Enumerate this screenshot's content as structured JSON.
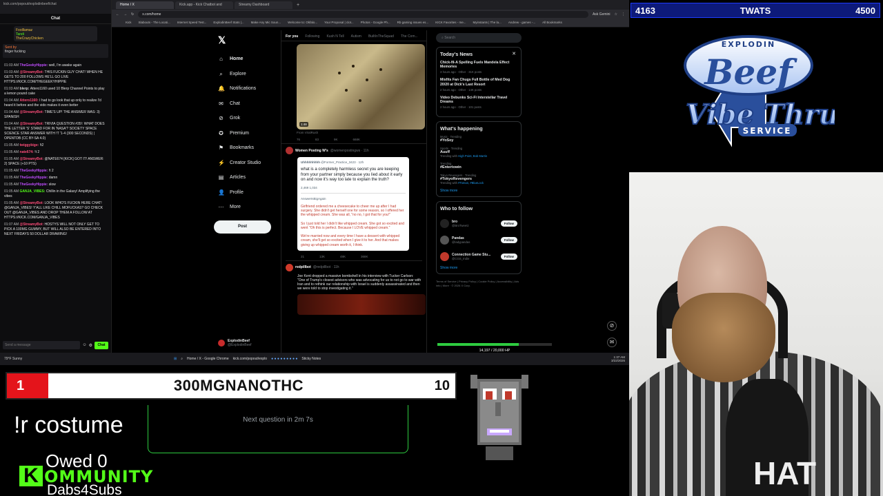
{
  "chat": {
    "url": "kick.com/popout/explodinbeef/chat",
    "title": "Chat",
    "pinned": {
      "line1": "Foolllamaz",
      "line2": "Tandi",
      "line3": "TheCrazyChicken"
    },
    "sent_by": "Sent by",
    "sent_text": "finger fucking",
    "messages": [
      {
        "ts": "01:03 AM",
        "user": "TheGeekyHippie:",
        "color": "#c04dff",
        "text": "well, I'm awake again"
      },
      {
        "ts": "01:03 AM",
        "user": "@StreamyBot:",
        "color": "#ff4d7a",
        "text": "THIS FUCKIN GUY CHAT! WHEN HE GETS TO 200 FOLLOWS HE'LL GO LIVE HTTPS://KICK.COM/THEGEEKYHIPPIE"
      },
      {
        "ts": "01:03 AM",
        "user": "blerp:",
        "color": "#dddddd",
        "text": "Attero1160 used 10 Blerp Channel Points to play a lemon pound cake"
      },
      {
        "ts": "01:04 AM",
        "user": "Attero1160:",
        "color": "#ff4d7a",
        "text": "I had to go look that up only to realize I'd heard it before and the vido makes it even better"
      },
      {
        "ts": "01:04 AM",
        "user": "@StreamyBot:",
        "color": "#ff4d7a",
        "text": "TIME'S UP! THE ANSWER WAS: 3) SPANISH"
      },
      {
        "ts": "01:04 AM",
        "user": "@StreamyBot:",
        "color": "#ff4d7a",
        "text": "TRIVIA QUESTION #35!: WHAT DOES THE LETTER 'S' STAND FOR IN 'NASA'? SOCIETY SPACE SCIENCE STAR ANSWER WITH !T '1-4 (300 SECONDS) | OPENTDB (CC BY-SA 4.0)"
      },
      {
        "ts": "01:05 AM",
        "user": "twiggybige:",
        "color": "#ff4d7a",
        "text": "!t2"
      },
      {
        "ts": "01:05 AM",
        "user": "nate674:",
        "color": "#ff4d7a",
        "text": "!t 2"
      },
      {
        "ts": "01:05 AM",
        "user": "@StreamyBot:",
        "color": "#ff4d7a",
        "text": "@NATE674 [KICK] GOT IT! ANSWER: 2) SPACE (+10 PTS)"
      },
      {
        "ts": "01:05 AM",
        "user": "TheGeekyHippie:",
        "color": "#c04dff",
        "text": "!t 2"
      },
      {
        "ts": "01:05 AM",
        "user": "TheGeekyHippie:",
        "color": "#c04dff",
        "text": "damn"
      },
      {
        "ts": "01:05 AM",
        "user": "TheGeekyHippie:",
        "color": "#c04dff",
        "text": "slow"
      },
      {
        "ts": "01:05 AM",
        "user": "GANJA_VIBES:",
        "color": "#53fc18",
        "text": "Chillin in the Galaxy! Amplifying the vibes"
      },
      {
        "ts": "01:05 AM",
        "user": "@StreamyBot:",
        "color": "#ff4d7a",
        "text": "LOOK WHO'S FUCKIN HERE CHAT! @GANJA_VIBES! Y'ALL LIKE CHILL MOFUCKAS? GO CHECK OUT @GANJA_VIBES AND DROP THEM A FOLLOW AT HTTPS://KICK.COM/GANJA_VIBES"
      },
      {
        "ts": "01:07 AM",
        "user": "@StreamyBot:",
        "color": "#ff4d7a",
        "text": "HOSTYS WILL NOT ONLY GET TO PICK A 100MG GUMMY, BUT WILL ALSO BE ENTERED INTO NEXT FRIDAYS 50 DOLLAR DRAWING!"
      }
    ],
    "input_placeholder": "Send a message",
    "send_label": "Chat"
  },
  "browser": {
    "tabs": [
      "Home / X",
      "Kick.app - Kick Chatbot and",
      "Streamy Dashboard"
    ],
    "url": "x.com/home",
    "bookmarks": [
      "Kick",
      "Slabouts - The Locati...",
      "Internet Speed Test...",
      "ExplodinBeef Stats |...",
      "Make Any Mic Soun...",
      "Welcome to: Okfalo...",
      "Your Proposal | clot...",
      "Photos - Google Ph...",
      "Rb gaming issues es...",
      "KICK Favorites - me...",
      "Myinstants | The la...",
      "Andrew - games -...",
      "All Bookmarks"
    ],
    "ask": "Ask Gemini"
  },
  "x": {
    "nav": [
      "Home",
      "Explore",
      "Notifications",
      "Chat",
      "Grok",
      "Premium",
      "Bookmarks",
      "Creator Studio",
      "Articles",
      "Profile",
      "More"
    ],
    "post_button": "Post",
    "me_name": "ExplodinBeef",
    "me_handle": "@ExplodinBeef",
    "feed_tabs": [
      "For you",
      "Following",
      "Kush N Tell",
      "Autism",
      "BuiltInTheSquad",
      "The Com..."
    ],
    "video_duration": "1:48",
    "video_source": "From ViralRush",
    "actions1": [
      "76",
      "83",
      "9K",
      "668K"
    ],
    "post1": {
      "name": "Women Posting W's",
      "handle": "@womenpostingws · 11h",
      "quote_user": "Uhhhhhhhhh",
      "quote_handle": "@Former_Practice_3423 · 12h",
      "quote_text": "what is a completely harmless secret you are keeping from your partner simply because you lied about it early on and now it's way too late to explain the truth?",
      "quote_stats": "2,469   1,034",
      "reply_handle": "AnswerIsBigAgain",
      "reply_text": "Girlfriend ordered me a cheesecake to cheer me up after I had surgery. She didn't get herself one for some reason, so I offered her the whipped cream. She was all, \"no no, I got that for you!\"\n\nSo I just told her I didn't like whipped cream. She got so excited and went \"Oh this is perfect. Because I LOVE whipped cream.\"\n\nWe're married now and every time I have a dessert with whipped cream, she'll get so excited when I give it to her. And that makes giving up whipped cream worth it, I think.",
      "actions": [
        "21",
        "13K",
        "48K",
        "368K"
      ]
    },
    "post2": {
      "name": "redpillbot",
      "handle": "@redpillbot · 11h",
      "text": "Joe Kent dropped a massive bombshell in his interview with Tucker Carlson: \"One of Trump's closest advisors who was advocating for us to not go to war with Iran and to rethink our relationship with Israel is suddenly assassinated and then we were told to stop investigating it.\""
    },
    "search_placeholder": "Search",
    "todays_news": {
      "title": "Today's News",
      "items": [
        {
          "title": "Chick-fil-A Spelling Fuels Mandela Effect Memories",
          "meta": "3 hours ago · Other · 31K posts"
        },
        {
          "title": "Misfits Fan Chugs Full Bottle of Med Dog 20/20 at Dick's Last Resort",
          "meta": "2 hours ago · Other · 14K posts"
        },
        {
          "title": "Video Debunks Sci-Fi Interstellar Travel Dreams",
          "meta": "2 hours ago · Other · 101 posts"
        }
      ]
    },
    "whats_happening": {
      "title": "What's happening",
      "trends": [
        {
          "cat": "Music · Trending",
          "tag": "#YoSoy",
          "sub": ""
        },
        {
          "cat": "Sports · Trending",
          "tag": "Auuff",
          "sub": "Trending with",
          "with": "High Point, Bob Martin"
        },
        {
          "cat": "Trending",
          "tag": "#Entertowin",
          "sub": ""
        },
        {
          "cat": "Tokyo Revengers · Trending",
          "tag": "#TokyoRevengers",
          "sub": "Trending with",
          "with": "#Toman, #BlueLock"
        }
      ],
      "show_more": "Show more"
    },
    "who_to_follow": {
      "title": "Who to follow",
      "users": [
        {
          "name": "bro",
          "handle": "@BroTweetz",
          "color": "#222222"
        },
        {
          "name": "Pandas",
          "handle": "@ladypandas",
          "color": "#555555"
        },
        {
          "name": "Connection Game Stu...",
          "handle": "@CGS_Indie",
          "color": "#c0392b"
        }
      ],
      "follow_label": "Follow",
      "show_more": "Show more"
    },
    "footer": "Terms of Service | Privacy Policy | Cookie Policy | Accessibility | Ads info | More · © 2026 X Corp."
  },
  "hp": {
    "current": 14197,
    "max": 20000,
    "text": "14,197 / 20,000 HP"
  },
  "taskbar": {
    "weather_temp": "79°F",
    "weather_desc": "Sunny",
    "apps": [
      "Home / X - Google Chrome",
      "kick.com/popout/explo",
      "Sticky Notes"
    ],
    "time": "1:37 AM",
    "date": "3/22/2026"
  },
  "counter": {
    "left": "4163",
    "center": "TWATS",
    "right": "4500"
  },
  "logo": {
    "top": "EXPLODIN",
    "main": "Beef",
    "sub": "Vibe Thru",
    "service": "SERVICE"
  },
  "quiz": {
    "rank": "1",
    "name": "300MGNANOTHC",
    "points": "10"
  },
  "command": "!r costume",
  "next_question": "Next question in 2m 7s",
  "owed": "Owed 0",
  "community": {
    "first": "K",
    "rest": "OMMUNITY"
  },
  "dabs": "Dabs4Subs",
  "shirt_text": "HAT",
  "colors": {
    "kick_green": "#53fc18",
    "counter_blue": "#0d1a7a",
    "quiz_red": "#e4141b",
    "x_blue": "#1d9bf0"
  }
}
